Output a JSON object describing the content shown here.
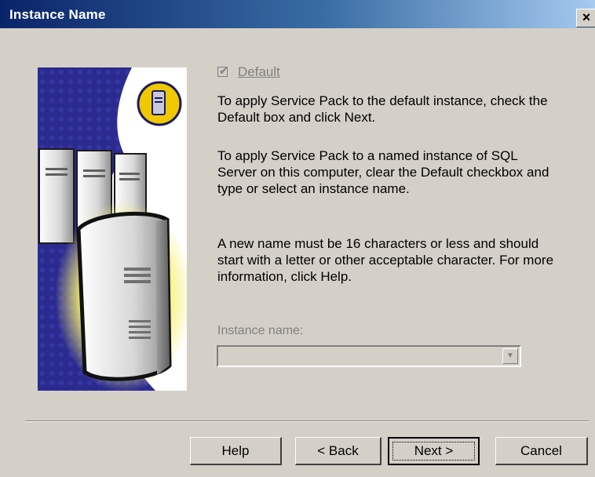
{
  "window": {
    "title": "Instance Name",
    "close_label": "×"
  },
  "default_checkbox": {
    "label": "Default",
    "checked": true,
    "enabled": false
  },
  "paragraphs": [
    "To apply Service Pack to the default instance,  check the Default box and click Next.",
    "To apply Service Pack to a named instance of SQL Server on this computer, clear the Default checkbox and type or select an instance name.",
    "A new name must be 16 characters or less and should start with a letter or other acceptable character.  For more information, click Help."
  ],
  "instance_name": {
    "label": "Instance name:",
    "value": "",
    "enabled": false
  },
  "buttons": {
    "help": "Help",
    "back": "< Back",
    "next": "Next >",
    "cancel": "Cancel"
  },
  "colors": {
    "titlebar_start": "#0a246a",
    "titlebar_end": "#a6caf0",
    "dialog_bg": "#d4d0c8",
    "disabled_text": "#808080"
  },
  "icons": {
    "artwork": "sql-server-computers-illustration",
    "badge": "server-tower-badge-icon"
  }
}
